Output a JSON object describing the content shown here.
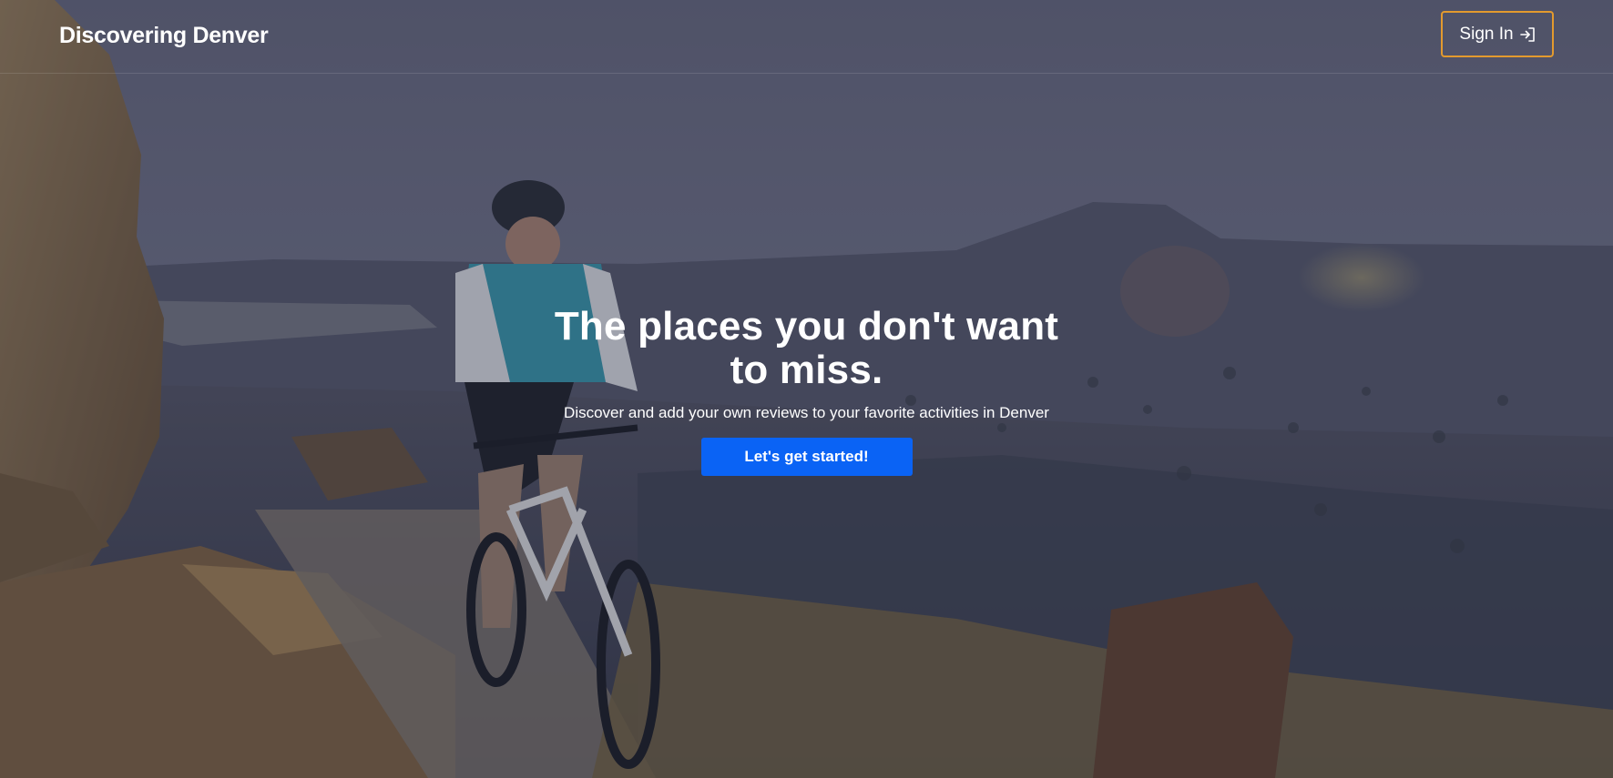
{
  "navbar": {
    "brand": "Discovering Denver",
    "signin_label": "Sign In",
    "signin_icon": "sign-in-arrow-icon",
    "signin_border_color": "#e39a2e"
  },
  "hero": {
    "headline": "The places you don't want to miss.",
    "subtitle": "Discover and add your own reviews to your favorite activities in Denver",
    "cta_label": "Let's get started!",
    "cta_color": "#0a63f5",
    "background_image": "mountain-biker-desert-canyon-photo"
  }
}
